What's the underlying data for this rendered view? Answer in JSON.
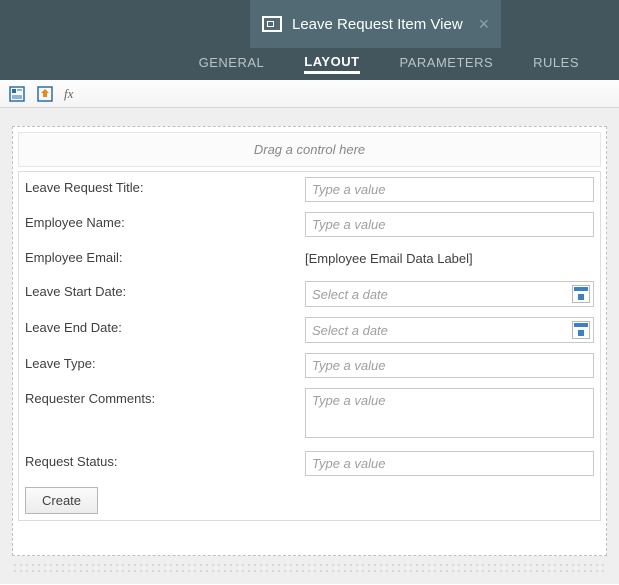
{
  "header": {
    "title": "Leave Request Item View"
  },
  "tabs": {
    "general": "GENERAL",
    "layout": "LAYOUT",
    "parameters": "PARAMETERS",
    "rules": "RULES",
    "active": "layout"
  },
  "canvas": {
    "drop_hint": "Drag a control here"
  },
  "form": {
    "title_label": "Leave Request Title:",
    "title_placeholder": "Type a value",
    "empname_label": "Employee Name:",
    "empname_placeholder": "Type a value",
    "empemail_label": "Employee Email:",
    "empemail_value": "[Employee Email Data Label]",
    "start_label": "Leave Start Date:",
    "start_placeholder": "Select a date",
    "end_label": "Leave End Date:",
    "end_placeholder": "Select a date",
    "type_label": "Leave Type:",
    "type_placeholder": "Type a value",
    "comments_label": "Requester Comments:",
    "comments_placeholder": "Type a value",
    "status_label": "Request Status:",
    "status_placeholder": "Type a value",
    "create_button": "Create"
  }
}
